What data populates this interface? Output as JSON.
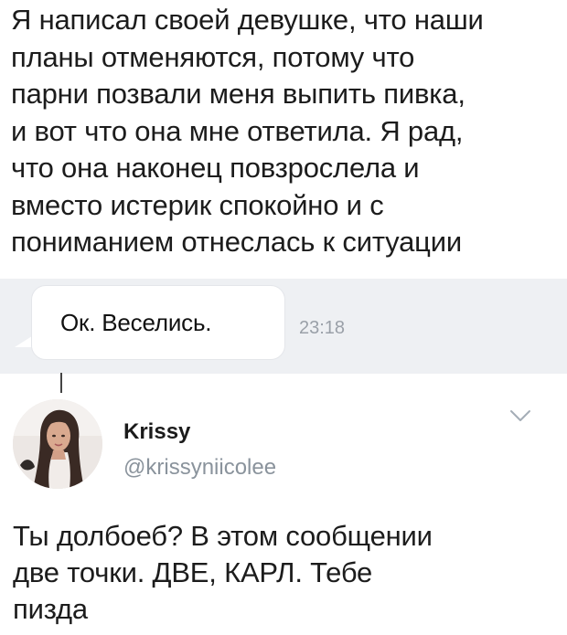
{
  "post": {
    "text": "Я написал своей девушке, что наши\nпланы отменяются, потому что\nпарни позвали меня выпить пивка,\nи вот что она мне ответила. Я рад,\nчто она наконец повзрослела и\nвместо истерик спокойно и с\nпониманием отнеслась к ситуации"
  },
  "message": {
    "text": "Ок. Веселись.",
    "time": "23:18"
  },
  "tweet": {
    "name": "Krissy",
    "handle": "@krissyniicolee",
    "text": "Ты долбоеб? В этом сообщении\nдве точки. ДВЕ, КАРЛ. Тебе\nпизда",
    "avatar_icon": "profile-photo",
    "menu_icon": "chevron-down-icon"
  },
  "colors": {
    "message_strip": "#eef0f3",
    "bubble": "#ffffff",
    "time": "#9aa0a8",
    "handle": "#8a939c"
  }
}
